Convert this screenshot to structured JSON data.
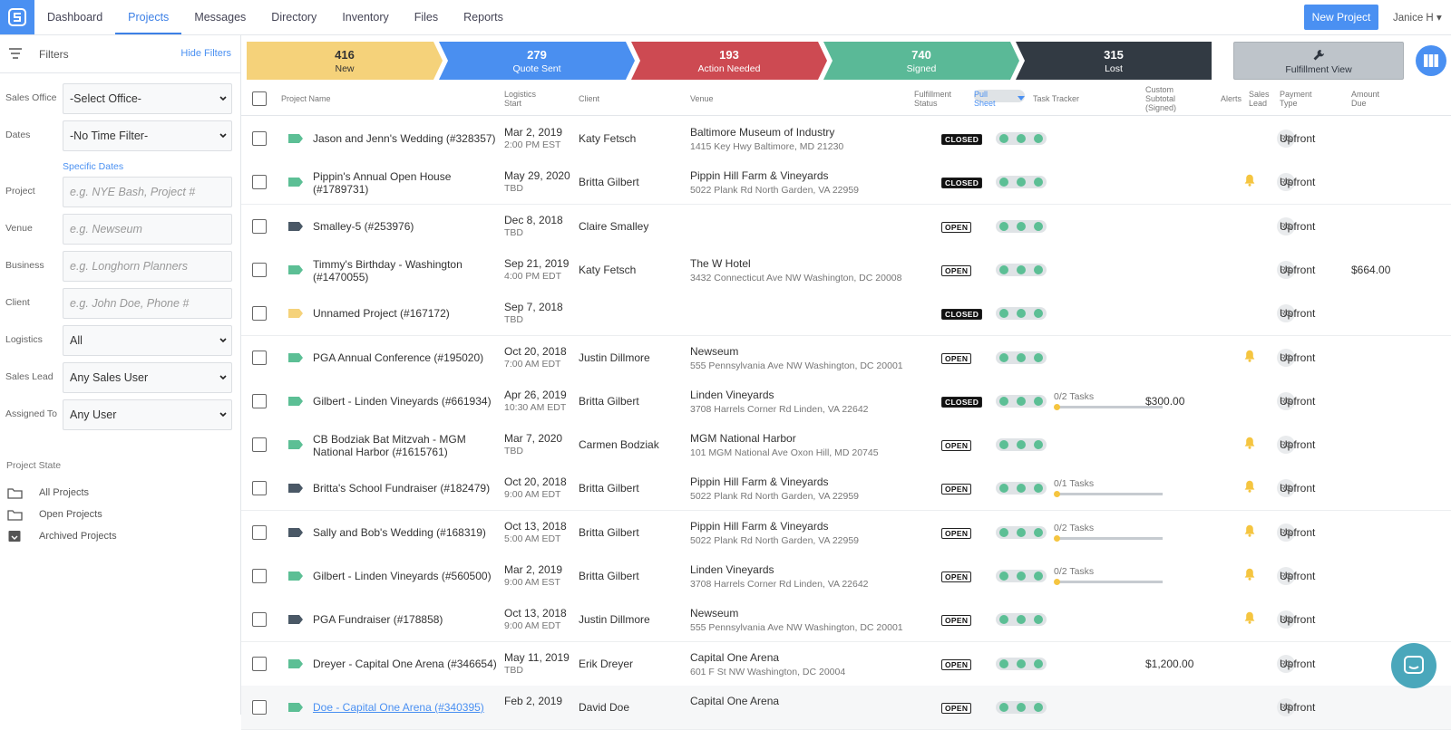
{
  "nav": {
    "logo": "logo-icon",
    "links": [
      "Dashboard",
      "Projects",
      "Messages",
      "Directory",
      "Inventory",
      "Files",
      "Reports"
    ],
    "active": "Projects",
    "new_project": "New Project",
    "user": "Janice H"
  },
  "sidebar": {
    "title": "Filters",
    "hide": "Hide Filters",
    "sales_office": {
      "label": "Sales Office",
      "value": "-Select Office-"
    },
    "dates": {
      "label": "Dates",
      "value": "-No Time Filter-"
    },
    "specific_dates": "Specific Dates",
    "project": {
      "label": "Project",
      "placeholder": "e.g. NYE Bash, Project #"
    },
    "venue": {
      "label": "Venue",
      "placeholder": "e.g. Newseum"
    },
    "business": {
      "label": "Business",
      "placeholder": "e.g. Longhorn Planners"
    },
    "client": {
      "label": "Client",
      "placeholder": "e.g. John Doe, Phone #"
    },
    "logistics": {
      "label": "Logistics",
      "value": "All"
    },
    "sales_lead": {
      "label": "Sales Lead",
      "value": "Any Sales User"
    },
    "assigned_to": {
      "label": "Assigned To",
      "value": "Any User"
    },
    "project_state": "Project State",
    "states": [
      "All Projects",
      "Open Projects",
      "Archived Projects"
    ]
  },
  "funnel": [
    {
      "count": "416",
      "label": "New",
      "color": "#f5d27a",
      "text": "#333"
    },
    {
      "count": "279",
      "label": "Quote Sent",
      "color": "#4a8ff0",
      "text": "#fff"
    },
    {
      "count": "193",
      "label": "Action Needed",
      "color": "#cd4a52",
      "text": "#fff"
    },
    {
      "count": "740",
      "label": "Signed",
      "color": "#5ab997",
      "text": "#fff"
    },
    {
      "count": "315",
      "label": "Lost",
      "color": "#323a43",
      "text": "#fff"
    }
  ],
  "fulfillment_view": "Fulfillment View",
  "columns": {
    "name": "Project Name",
    "logistics": [
      "Logistics",
      "Start"
    ],
    "client": "Client",
    "venue": "Venue",
    "fstatus": [
      "Fulfillment",
      "Status"
    ],
    "pull": [
      "Pull",
      "Sheet"
    ],
    "task": "Task Tracker",
    "subtotal": [
      "Custom",
      "Subtotal",
      "(Signed)"
    ],
    "alerts": "Alerts",
    "lead": [
      "Sales",
      "Lead"
    ],
    "payment": [
      "Payment",
      "Type"
    ],
    "due": [
      "Amount",
      "Due"
    ]
  },
  "colors": {
    "tag_green": "#5cbf95",
    "tag_dark": "#4a5866",
    "tag_yellow": "#f5d27a",
    "bell": "#f5c540"
  },
  "rows": [
    {
      "tag": "green",
      "name": "Jason and Jenn's Wedding (#328357)",
      "date": "Mar 2, 2019",
      "time": "2:00 PM EST",
      "client": "Katy Fetsch",
      "venue": "Baltimore Museum of Industry",
      "address": "1415 Key Hwy Baltimore, MD 21230",
      "status": "CLOSED",
      "tasks": "",
      "subtotal": "",
      "alert": false,
      "lead": "RG",
      "payment": "Upfront",
      "due": ""
    },
    {
      "tag": "green",
      "name": "Pippin's Annual Open House (#1789731)",
      "date": "May 29, 2020",
      "time": "TBD",
      "client": "Britta Gilbert",
      "venue": "Pippin Hill Farm & Vineyards",
      "address": "5022 Plank Rd North Garden, VA 22959",
      "status": "CLOSED",
      "tasks": "",
      "subtotal": "",
      "alert": true,
      "lead": "RG",
      "payment": "Upfront",
      "due": ""
    },
    {
      "tag": "dark",
      "name": "Smalley-5 (#253976)",
      "date": "Dec 8, 2018",
      "time": "TBD",
      "client": "Claire Smalley",
      "venue": "",
      "address": "",
      "status": "OPEN",
      "tasks": "",
      "subtotal": "",
      "alert": false,
      "lead": "RG",
      "payment": "Upfront",
      "due": ""
    },
    {
      "tag": "green",
      "name": "Timmy's Birthday - Washington (#1470055)",
      "date": "Sep 21, 2019",
      "time": "4:00 PM EDT",
      "client": "Katy Fetsch",
      "venue": "The W Hotel",
      "address": "3432 Connecticut Ave NW Washington, DC 20008",
      "status": "OPEN",
      "tasks": "",
      "subtotal": "",
      "alert": false,
      "lead": "RG",
      "payment": "Upfront",
      "due": "$664.00"
    },
    {
      "tag": "yellow",
      "name": "Unnamed Project (#167172)",
      "date": "Sep 7, 2018",
      "time": "TBD",
      "client": "",
      "venue": "",
      "address": "",
      "status": "CLOSED",
      "tasks": "",
      "subtotal": "",
      "alert": false,
      "lead": "RG",
      "payment": "Upfront",
      "due": ""
    },
    {
      "tag": "green",
      "name": "PGA Annual Conference (#195020)",
      "date": "Oct 20, 2018",
      "time": "7:00 AM EDT",
      "client": "Justin Dillmore",
      "venue": "Newseum",
      "address": "555 Pennsylvania Ave NW Washington, DC 20001",
      "status": "OPEN",
      "tasks": "",
      "subtotal": "",
      "alert": true,
      "lead": "RG",
      "payment": "Upfront",
      "due": ""
    },
    {
      "tag": "green",
      "name": "Gilbert - Linden Vineyards (#661934)",
      "date": "Apr 26, 2019",
      "time": "10:30 AM EDT",
      "client": "Britta Gilbert",
      "venue": "Linden Vineyards",
      "address": "3708 Harrels Corner Rd Linden, VA 22642",
      "status": "CLOSED",
      "tasks": "0/2 Tasks",
      "subtotal": "$300.00",
      "alert": false,
      "lead": "RG",
      "payment": "Upfront",
      "due": ""
    },
    {
      "tag": "green",
      "name": "CB Bodziak Bat Mitzvah - MGM National Harbor (#1615761)",
      "date": "Mar 7, 2020",
      "time": "TBD",
      "client": "Carmen Bodziak",
      "venue": "MGM National Harbor",
      "address": "101 MGM National Ave Oxon Hill, MD 20745",
      "status": "OPEN",
      "tasks": "",
      "subtotal": "",
      "alert": true,
      "lead": "RG",
      "payment": "Upfront",
      "due": ""
    },
    {
      "tag": "dark",
      "name": "Britta's School Fundraiser (#182479)",
      "date": "Oct 20, 2018",
      "time": "9:00 AM EDT",
      "client": "Britta Gilbert",
      "venue": "Pippin Hill Farm & Vineyards",
      "address": "5022 Plank Rd North Garden, VA 22959",
      "status": "OPEN",
      "tasks": "0/1 Tasks",
      "subtotal": "",
      "alert": true,
      "lead": "RG",
      "payment": "Upfront",
      "due": ""
    },
    {
      "tag": "dark",
      "name": "Sally and Bob's Wedding (#168319)",
      "date": "Oct 13, 2018",
      "time": "5:00 AM EDT",
      "client": "Britta Gilbert",
      "venue": "Pippin Hill Farm & Vineyards",
      "address": "5022 Plank Rd North Garden, VA 22959",
      "status": "OPEN",
      "tasks": "0/2 Tasks",
      "subtotal": "",
      "alert": true,
      "lead": "RG",
      "payment": "Upfront",
      "due": ""
    },
    {
      "tag": "green",
      "name": "Gilbert - Linden Vineyards (#560500)",
      "date": "Mar 2, 2019",
      "time": "9:00 AM EST",
      "client": "Britta Gilbert",
      "venue": "Linden Vineyards",
      "address": "3708 Harrels Corner Rd Linden, VA 22642",
      "status": "OPEN",
      "tasks": "0/2 Tasks",
      "subtotal": "",
      "alert": true,
      "lead": "RG",
      "payment": "Upfront",
      "due": ""
    },
    {
      "tag": "dark",
      "name": "PGA Fundraiser (#178858)",
      "date": "Oct 13, 2018",
      "time": "9:00 AM EDT",
      "client": "Justin Dillmore",
      "venue": "Newseum",
      "address": "555 Pennsylvania Ave NW Washington, DC 20001",
      "status": "OPEN",
      "tasks": "",
      "subtotal": "",
      "alert": true,
      "lead": "RG",
      "payment": "Upfront",
      "due": ""
    },
    {
      "tag": "green",
      "name": "Dreyer - Capital One Arena (#346654)",
      "date": "May 11, 2019",
      "time": "TBD",
      "client": "Erik Dreyer",
      "venue": "Capital One Arena",
      "address": "601 F St NW Washington, DC 20004",
      "status": "OPEN",
      "tasks": "",
      "subtotal": "$1,200.00",
      "alert": false,
      "lead": "RG",
      "payment": "Upfront",
      "due": ""
    },
    {
      "tag": "green",
      "name": "Doe - Capital One Arena (#340395)",
      "date": "Feb 2, 2019",
      "time": "",
      "client": "David Doe",
      "venue": "Capital One Arena",
      "address": "",
      "status": "OPEN",
      "tasks": "",
      "subtotal": "",
      "alert": false,
      "lead": "RG",
      "payment": "Upfront",
      "due": "",
      "link": true
    }
  ]
}
